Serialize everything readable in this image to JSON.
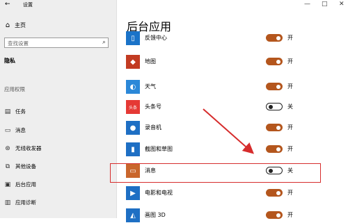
{
  "window": {
    "back_glyph": "←",
    "title": "设置",
    "controls": [
      "—",
      "□",
      "✕"
    ]
  },
  "sidebar": {
    "home": {
      "icon": "home-icon",
      "label": "主页"
    },
    "search": {
      "placeholder": "查找设置"
    },
    "current": "隐私",
    "group_header": "应用权限",
    "items": [
      {
        "icon": "task-icon",
        "label": "任务"
      },
      {
        "icon": "message-icon",
        "label": "消息"
      },
      {
        "icon": "radio-icon",
        "label": "无线收发器"
      },
      {
        "icon": "devices-icon",
        "label": "其他设备"
      },
      {
        "icon": "background-apps-icon",
        "label": "后台应用"
      },
      {
        "icon": "diagnostics-icon",
        "label": "应用诊断"
      }
    ]
  },
  "main": {
    "title": "后台应用",
    "apps": [
      {
        "name": "反馈中心",
        "icon": "feedback-hub-icon",
        "color": "#1a73c8",
        "on": true,
        "state": "开"
      },
      {
        "name": "地图",
        "icon": "maps-icon",
        "color": "#c23b22",
        "on": true,
        "state": "开"
      },
      {
        "name": "天气",
        "icon": "weather-icon",
        "color": "#2b88d8",
        "on": true,
        "state": "开"
      },
      {
        "name": "头条号",
        "icon": "toutiao-icon",
        "color": "#e53935",
        "on": false,
        "state": "关"
      },
      {
        "name": "录音机",
        "icon": "recorder-icon",
        "color": "#1e6fc4",
        "on": true,
        "state": "开"
      },
      {
        "name": "截图和草图",
        "icon": "snip-sketch-icon",
        "color": "#1e6fc4",
        "on": true,
        "state": "开"
      },
      {
        "name": "消息",
        "icon": "messaging-icon",
        "color": "#c9662c",
        "on": false,
        "state": "关"
      },
      {
        "name": "电影和电视",
        "icon": "movies-tv-icon",
        "color": "#1e6fc4",
        "on": true,
        "state": "开"
      },
      {
        "name": "画图 3D",
        "icon": "paint3d-icon",
        "color": "#1e6fc4",
        "on": true,
        "state": "开"
      }
    ]
  },
  "annotation_color": "#d62c2c"
}
